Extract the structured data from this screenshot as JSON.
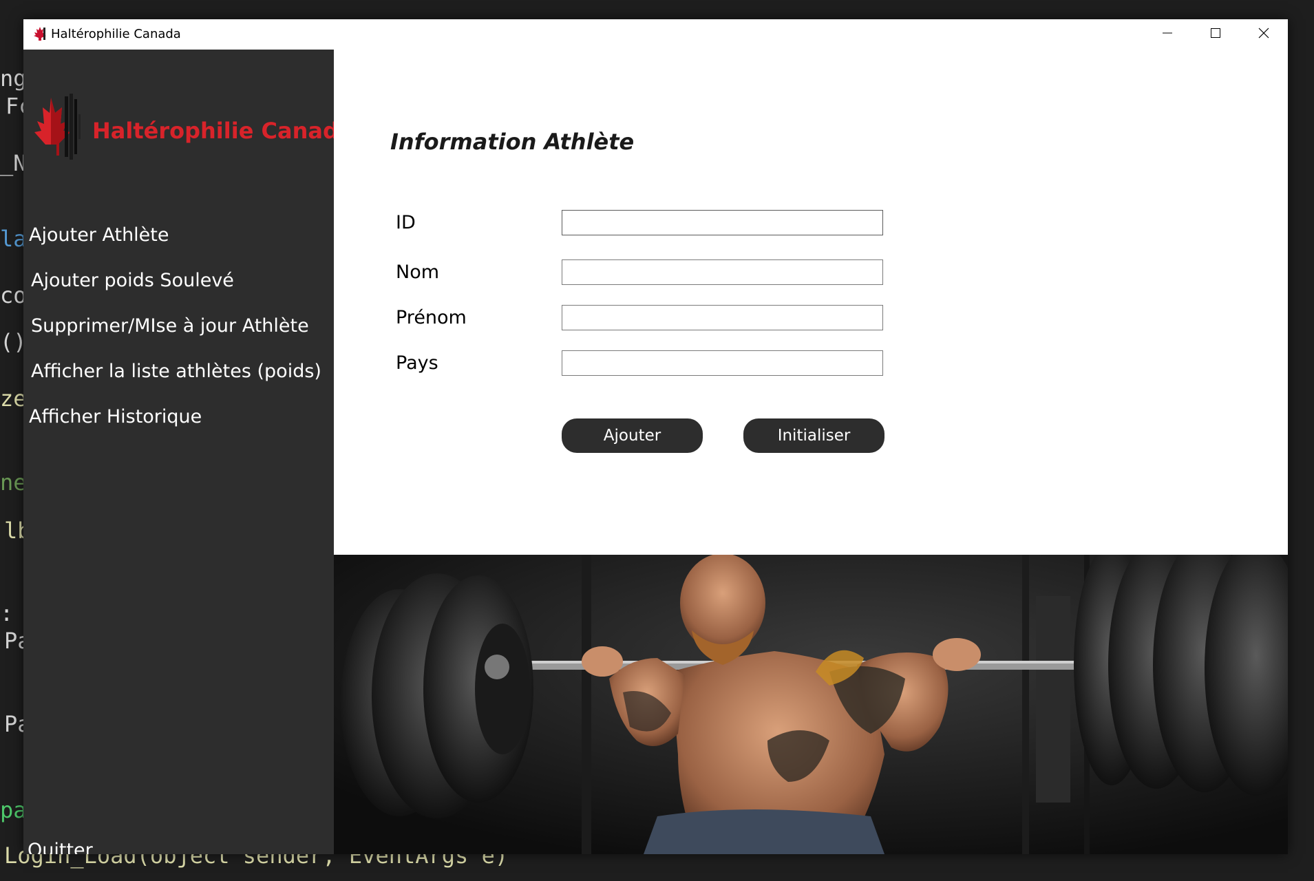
{
  "window": {
    "title": "Haltérophilie Canada"
  },
  "code_background": {
    "lines": [
      "ng.",
      "Fc",
      "_N",
      "las",
      "cou",
      "()",
      "zeC",
      "ne",
      "lb",
      ": %",
      "Pa",
      "Pa",
      "pa",
      "Login_Load(object sender, EventArgs e)"
    ]
  },
  "sidebar": {
    "logo_text": "Haltérophilie Canada",
    "items": [
      {
        "label": "Ajouter Athlète"
      },
      {
        "label": "Ajouter poids Soulevé"
      },
      {
        "label": "Supprimer/MIse à jour Athlète"
      },
      {
        "label": "Afficher la liste athlètes (poids)"
      },
      {
        "label": "Afficher Historique"
      }
    ],
    "quit_label": "Quitter"
  },
  "form": {
    "title": "Information Athlète",
    "fields": [
      {
        "label": "ID",
        "value": ""
      },
      {
        "label": "Nom",
        "value": ""
      },
      {
        "label": "Prénom",
        "value": ""
      },
      {
        "label": "Pays",
        "value": ""
      }
    ],
    "add_label": "Ajouter",
    "reset_label": "Initialiser"
  },
  "colors": {
    "sidebar_bg": "#2d2d2d",
    "brand_red": "#d8232a",
    "button_bg": "#2d2d2d"
  },
  "icons": [
    "app-maple-leaf-icon",
    "minimize-icon",
    "maximize-icon",
    "close-icon"
  ]
}
